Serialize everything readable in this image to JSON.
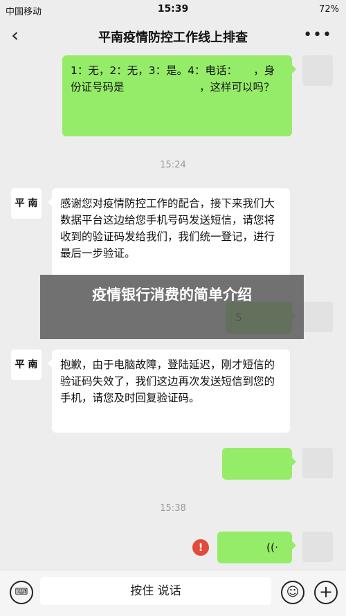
{
  "status": {
    "carrier": "中国移动",
    "time": "15:39",
    "battery": "72%"
  },
  "nav": {
    "title": "平南疫情防控工作线上排查",
    "back_icon": "‹",
    "more_icon": "•••"
  },
  "messages": [
    {
      "from": "me",
      "text": "1：无，2：无，3：是。4：电话：　　，身份证号码是　　　　　　　，这样可以吗？"
    },
    {
      "from": "other",
      "text": "感谢您对疫情防控工作的配合，接下来我们大数据平台这边给您手机号码发送短信，请您将收到的验证码发给我们，我们统一登记，进行最后一步验证。"
    },
    {
      "from": "me",
      "text": "5"
    },
    {
      "from": "other",
      "text": "抱歉，由于电脑故障，登陆延迟，刚才短信的验证码失效了，我们这边再次发送短信到您的手机，请您及时回复验证码。"
    }
  ],
  "times": [
    "15:24",
    "15:38"
  ],
  "contact_avatar": "平 南",
  "voice_icon": "((·",
  "error_icon": "!",
  "overlay": "疫情银行消费的简单介绍",
  "bottom": {
    "press_to_talk": "按住 说话",
    "keyboard_icon": "⌨",
    "emoji_icon": "☺",
    "plus_icon": "+"
  }
}
